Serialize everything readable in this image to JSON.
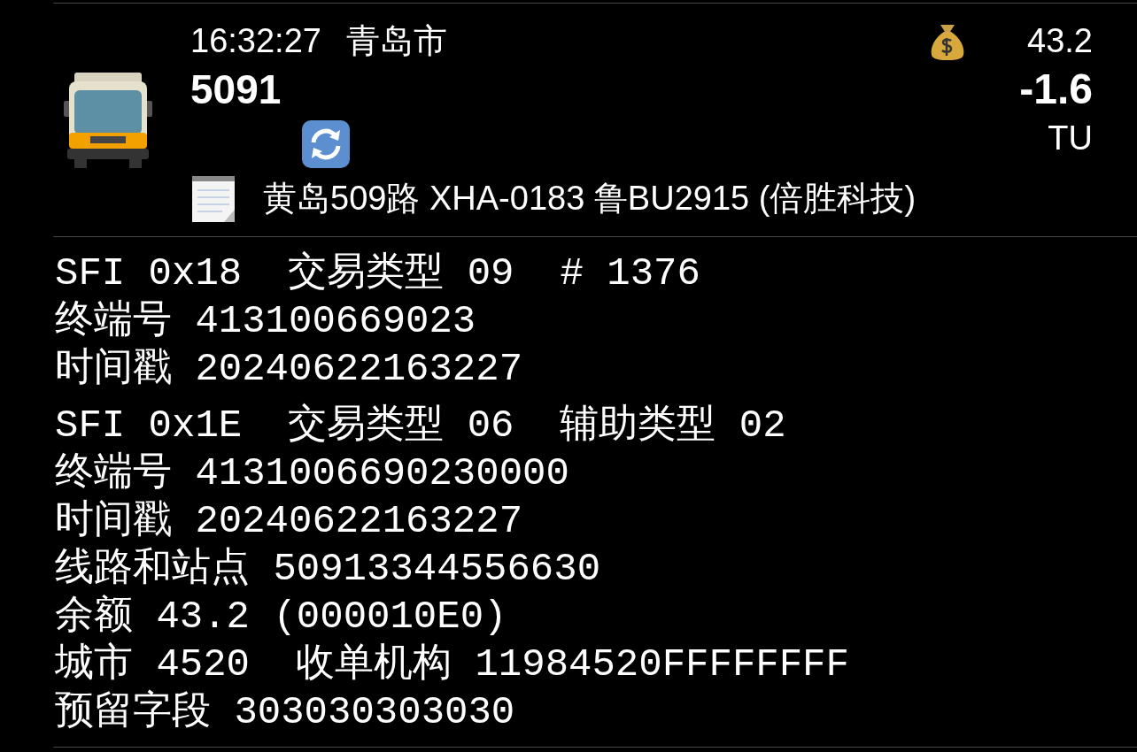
{
  "header": {
    "time": "16:32:27",
    "city": "青岛市",
    "route": "5091",
    "balance": "43.2",
    "amount": "-1.6",
    "unit": "TU",
    "description": "黄岛509路 XHA-0183 鲁BU2915 (倍胜科技)"
  },
  "records": [
    {
      "lines": [
        [
          "SFI 0x18",
          "交易类型 09",
          "# 1376"
        ],
        [
          "终端号 413100669023"
        ],
        [
          "时间戳 20240622163227"
        ]
      ]
    },
    {
      "lines": [
        [
          "SFI 0x1E",
          "交易类型 06",
          "辅助类型 02"
        ],
        [
          "终端号 4131006690230000"
        ],
        [
          "时间戳 20240622163227"
        ],
        [
          "线路和站点 50913344556630"
        ],
        [
          "余额 43.2 (000010E0)"
        ],
        [
          "城市 4520",
          "收单机构 11984520FFFFFFFF"
        ],
        [
          "预留字段 303030303030"
        ]
      ]
    }
  ]
}
